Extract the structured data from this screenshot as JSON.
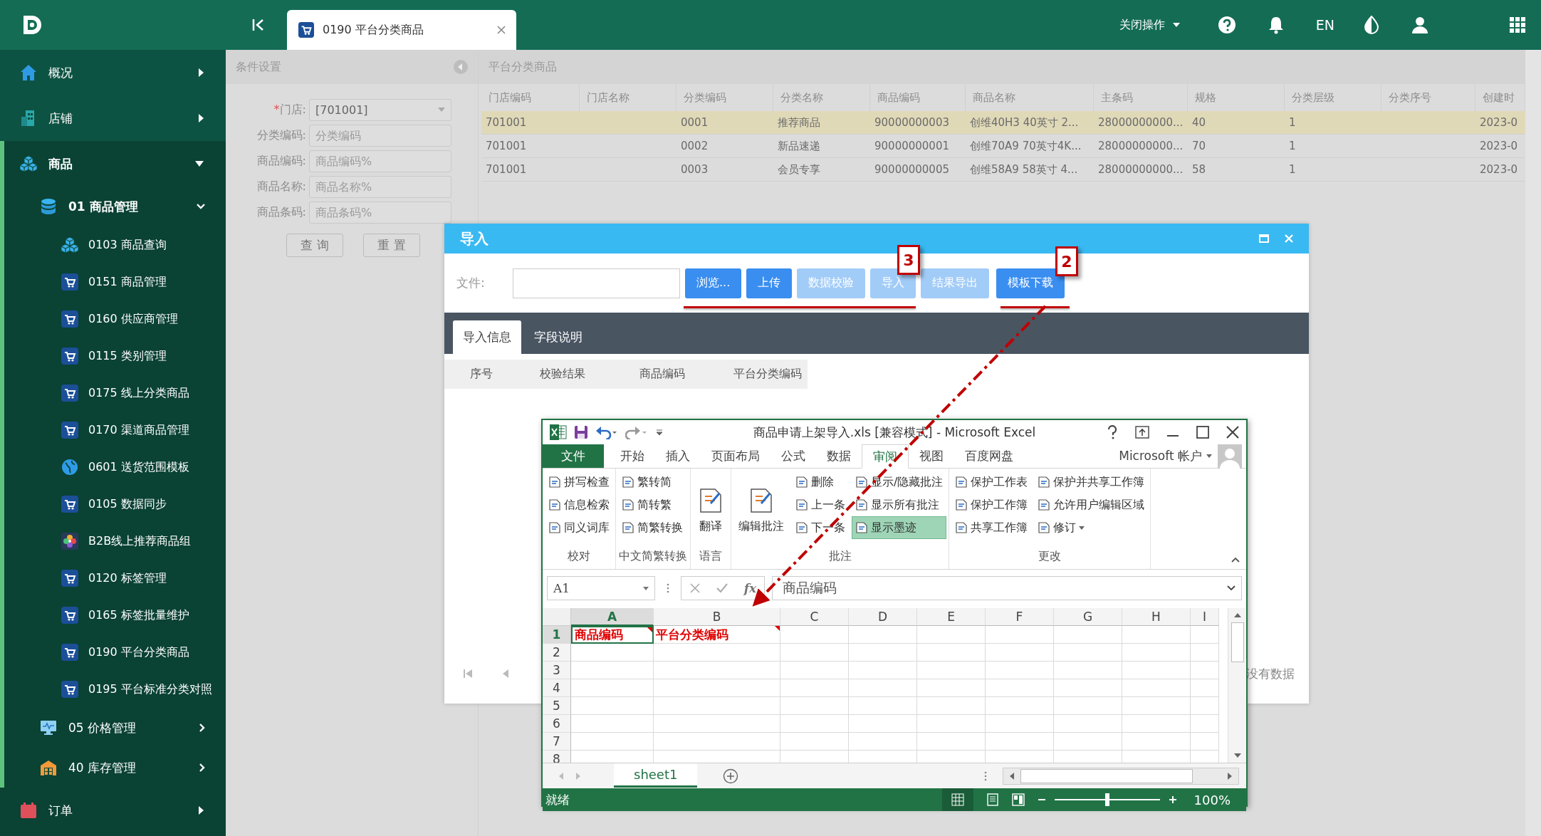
{
  "top_bar": {
    "tab": {
      "label": "0190 平台分类商品",
      "selected": true
    },
    "close_menu": "关闭操作",
    "language": "EN"
  },
  "sidebar": {
    "items": [
      {
        "label": "概况",
        "expanded": false
      },
      {
        "label": "店铺",
        "expanded": false
      },
      {
        "label": "商品",
        "expanded": true,
        "children": [
          {
            "label": "01 商品管理",
            "expanded": true,
            "children": [
              {
                "label": "0103 商品查询"
              },
              {
                "label": "0151 商品管理"
              },
              {
                "label": "0160 供应商管理"
              },
              {
                "label": "0115 类别管理"
              },
              {
                "label": "0175 线上分类商品"
              },
              {
                "label": "0170 渠道商品管理"
              },
              {
                "label": "0601 送货范围模板"
              },
              {
                "label": "0105 数据同步"
              },
              {
                "label": "B2B线上推荐商品组"
              },
              {
                "label": "0120 标签管理"
              },
              {
                "label": "0165 标签批量维护"
              },
              {
                "label": "0190 平台分类商品"
              },
              {
                "label": "0195 平台标准分类对照"
              }
            ]
          },
          {
            "label": "05 价格管理",
            "expanded": false
          },
          {
            "label": "40 库存管理",
            "expanded": false
          }
        ]
      },
      {
        "label": "订单",
        "expanded": false
      }
    ]
  },
  "filter_panel": {
    "title": "条件设置",
    "fields": [
      {
        "label": "门店:",
        "required_mark": "*",
        "kind": "dropdown",
        "value": "[701001]"
      },
      {
        "label": "分类编码:",
        "kind": "text",
        "placeholder": "分类编码"
      },
      {
        "label": "商品编码:",
        "kind": "text",
        "placeholder": "商品编码%"
      },
      {
        "label": "商品名称:",
        "kind": "text",
        "placeholder": "商品名称%"
      },
      {
        "label": "商品条码:",
        "kind": "text",
        "placeholder": "商品条码%"
      }
    ],
    "buttons": [
      "查 询",
      "重 置"
    ]
  },
  "table": {
    "title": "平台分类商品",
    "columns": [
      "门店编码",
      "门店名称",
      "分类编码",
      "分类名称",
      "商品编码",
      "商品名称",
      "主条码",
      "规格",
      "分类层级",
      "分类序号",
      "创建时"
    ],
    "rows": [
      {
        "selected": true,
        "cells": [
          "701001",
          "",
          "0001",
          "推荐商品",
          "90000000003",
          "创维40H3 40英寸 2...",
          "28000000000...",
          "40",
          "1",
          "",
          "2023-0"
        ]
      },
      {
        "selected": false,
        "cells": [
          "701001",
          "",
          "0002",
          "新品速递",
          "90000000001",
          "创维70A9 70英寸4K...",
          "28000000000...",
          "70",
          "1",
          "",
          "2023-0"
        ]
      },
      {
        "selected": false,
        "cells": [
          "701001",
          "",
          "0003",
          "会员专享",
          "90000000005",
          "创维58A9 58英寸 4...",
          "28000000000...",
          "58",
          "1",
          "",
          "2023-0"
        ]
      }
    ]
  },
  "import_dialog": {
    "title": "导入",
    "file_label": "文件:",
    "buttons": [
      {
        "label": "浏览...",
        "disabled": false
      },
      {
        "label": "上传",
        "disabled": false
      },
      {
        "label": "数据校验",
        "disabled": true
      },
      {
        "label": "导入",
        "disabled": true
      },
      {
        "label": "结果导出",
        "disabled": true
      },
      {
        "label": "模板下载",
        "disabled": false
      }
    ],
    "tabs": [
      {
        "label": "导入信息",
        "selected": true
      },
      {
        "label": "字段说明",
        "selected": false
      }
    ],
    "columns": [
      "序号",
      "校验结果",
      "商品编码",
      "平台分类编码"
    ],
    "empty_text": "没有数据"
  },
  "excel": {
    "title": "商品申请上架导入.xls  [兼容模式] - Microsoft Excel",
    "ribbon_tabs": [
      {
        "label": "文件",
        "kind": "file",
        "selected": false
      },
      {
        "label": "开始",
        "kind": "tab",
        "selected": false
      },
      {
        "label": "插入",
        "kind": "tab",
        "selected": false
      },
      {
        "label": "页面布局",
        "kind": "tab",
        "selected": false
      },
      {
        "label": "公式",
        "kind": "tab",
        "selected": false
      },
      {
        "label": "数据",
        "kind": "tab",
        "selected": false
      },
      {
        "label": "审阅",
        "kind": "tab",
        "selected": true
      },
      {
        "label": "视图",
        "kind": "tab",
        "selected": false
      },
      {
        "label": "百度网盘",
        "kind": "tab",
        "selected": false
      }
    ],
    "account": "Microsoft 帐户",
    "groups": [
      {
        "name": "校对",
        "items": [
          {
            "label": "拼写检查",
            "kind": "small",
            "on": false
          },
          {
            "label": "信息检索",
            "kind": "small",
            "on": false
          },
          {
            "label": "同义词库",
            "kind": "small",
            "on": false
          }
        ]
      },
      {
        "name": "中文简繁转换",
        "items": [
          {
            "label": "繁转简",
            "kind": "small",
            "on": false
          },
          {
            "label": "简转繁",
            "kind": "small",
            "on": false
          },
          {
            "label": "简繁转换",
            "kind": "small",
            "on": false
          }
        ]
      },
      {
        "name": "语言",
        "items": [
          {
            "label": "翻译",
            "kind": "large"
          }
        ]
      },
      {
        "name": "批注",
        "items": [
          {
            "label": "编辑批注",
            "kind": "large"
          },
          {
            "label": "删除",
            "kind": "small",
            "on": false
          },
          {
            "label": "上一条",
            "kind": "small",
            "on": false
          },
          {
            "label": "下一条",
            "kind": "small",
            "on": false
          },
          {
            "label": "显示/隐藏批注",
            "kind": "small",
            "on": false
          },
          {
            "label": "显示所有批注",
            "kind": "small",
            "on": false
          },
          {
            "label": "显示墨迹",
            "kind": "small",
            "on": true
          }
        ]
      },
      {
        "name": "更改",
        "items": [
          {
            "label": "保护工作表",
            "kind": "small",
            "on": false
          },
          {
            "label": "保护工作簿",
            "kind": "small",
            "on": false
          },
          {
            "label": "共享工作簿",
            "kind": "small",
            "on": false
          },
          {
            "label": "保护并共享工作簿",
            "kind": "small",
            "on": false
          },
          {
            "label": "允许用户编辑区域",
            "kind": "small",
            "on": false
          },
          {
            "label": "修订",
            "kind": "menu",
            "on": false
          }
        ]
      }
    ],
    "name_box": "A1",
    "function_label": "fx",
    "formula": "商品编码",
    "column_letters": [
      "A",
      "B",
      "C",
      "D",
      "E",
      "F",
      "G",
      "H",
      "I"
    ],
    "row_numbers": [
      "1",
      "2",
      "3",
      "4",
      "5",
      "6",
      "7",
      "8"
    ],
    "first_row": [
      "商品编码",
      "平台分类编码"
    ],
    "sheet_tab": "sheet1",
    "status": "就绪",
    "zoom": {
      "level": 0.5,
      "reading": "100%"
    }
  },
  "annotations": {
    "badges": [
      "3",
      "2"
    ]
  }
}
